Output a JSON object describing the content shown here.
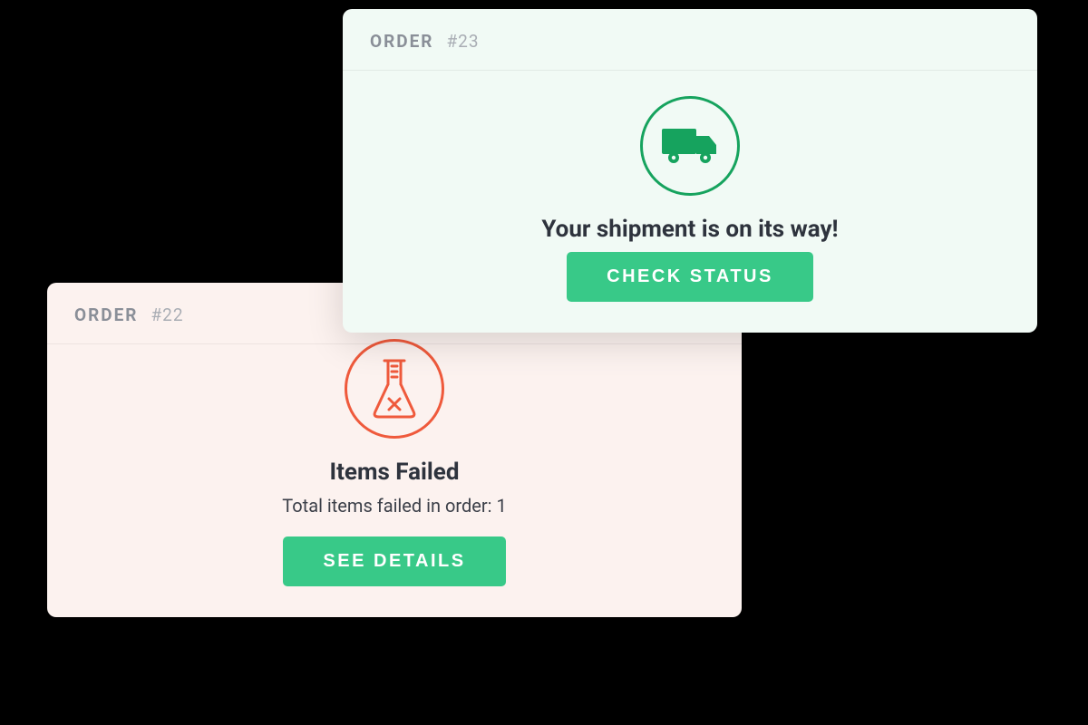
{
  "cards": {
    "shipment": {
      "header_label": "ORDER",
      "order_number": "#23",
      "title": "Your shipment is on its way!",
      "button": "CHECK STATUS",
      "accent": "#16a35e"
    },
    "failed": {
      "header_label": "ORDER",
      "order_number": "#22",
      "title": "Items Failed",
      "subtitle": "Total items failed in order: 1",
      "button": "SEE DETAILS",
      "accent": "#ef5a3c"
    }
  },
  "button_bg": "#38c988"
}
